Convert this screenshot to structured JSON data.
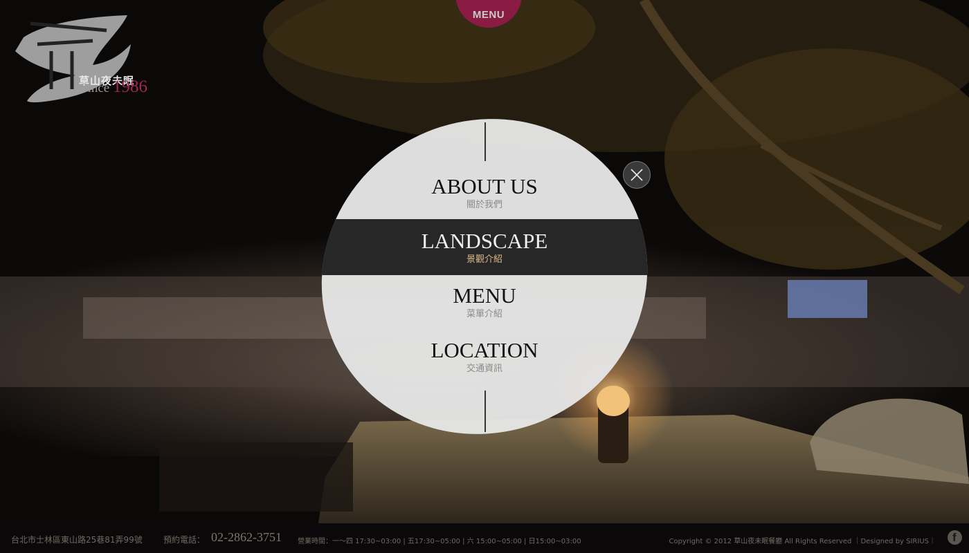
{
  "brand": {
    "logo_text": "草山夜未眠",
    "since_label": "Since",
    "since_year": "1986"
  },
  "top_menu": {
    "label": "MENU"
  },
  "nav": {
    "items": [
      {
        "title": "ABOUT US",
        "subtitle": "關於我們",
        "active": false
      },
      {
        "title": "LANDSCAPE",
        "subtitle": "景觀介紹",
        "active": true
      },
      {
        "title": "MENU",
        "subtitle": "菜單介紹",
        "active": false
      },
      {
        "title": "LOCATION",
        "subtitle": "交通資訊",
        "active": false
      }
    ],
    "close_icon": "close-icon"
  },
  "footer": {
    "address": "台北市士林區東山路25巷81弄99號",
    "phone_label": "預約電話：",
    "phone": "02-2862-3751",
    "hours": "營業時間：一～四 17:30~03:00 | 五17:30~05:00 | 六 15:00~05:00 | 日15:00~03:00",
    "copyright": "Copyright © 2012 草山夜未眠餐廳 All Rights Reserved ｜Designed by SIRIUS｜",
    "social_icon": "facebook-icon"
  },
  "colors": {
    "accent": "#8a1b43",
    "active_band": "#1c1c1c",
    "oval": "#e6e6e6"
  }
}
